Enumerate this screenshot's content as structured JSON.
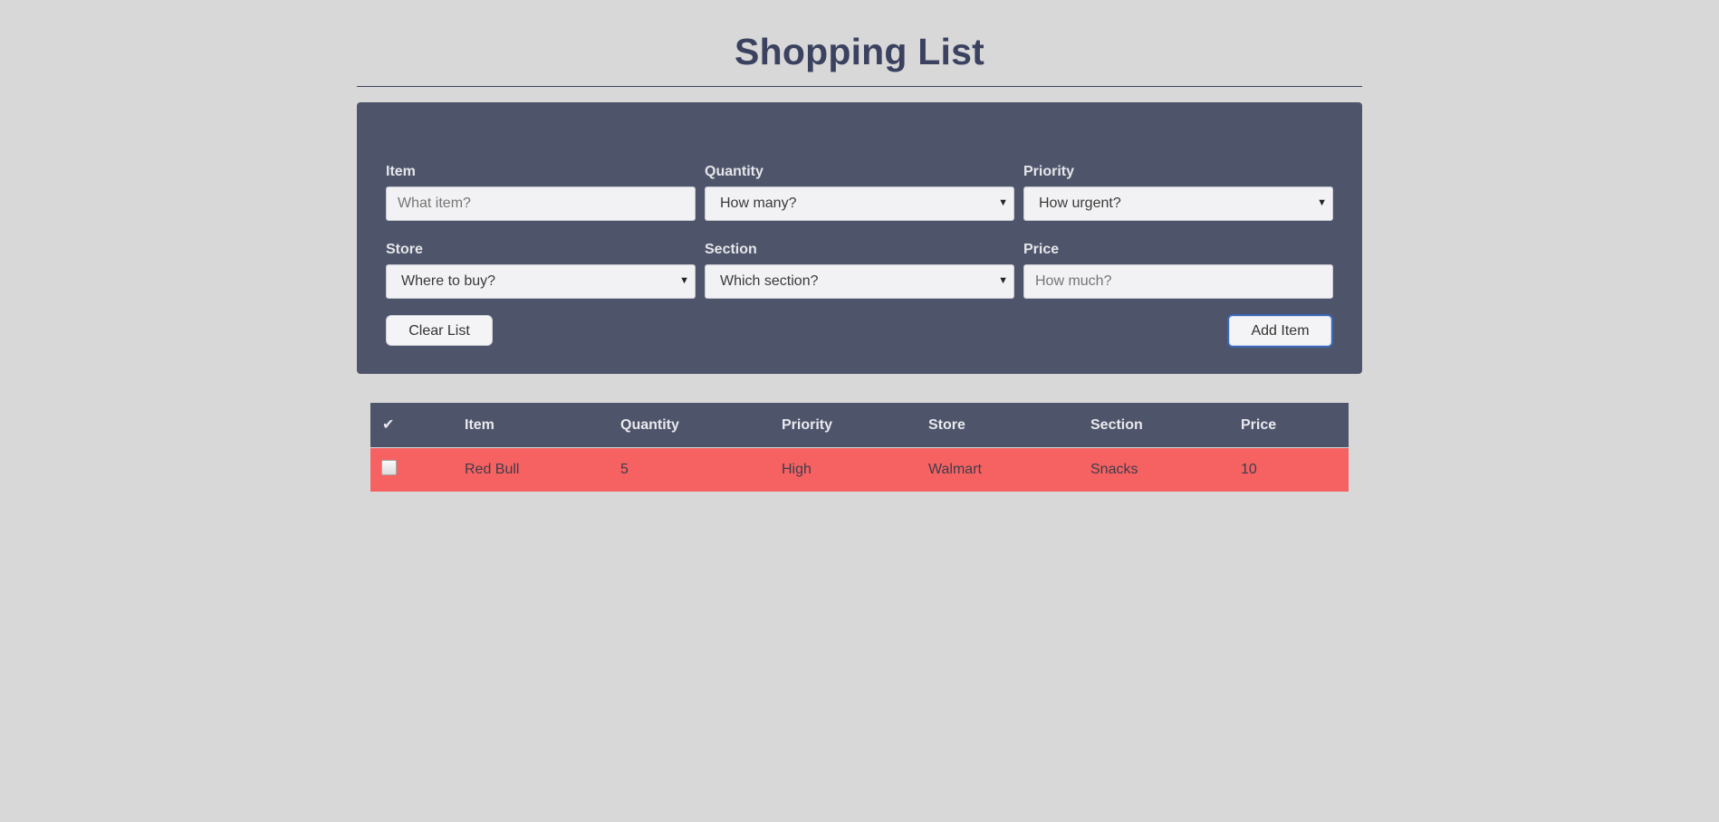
{
  "page": {
    "title": "Shopping List"
  },
  "form": {
    "item": {
      "label": "Item",
      "placeholder": "What item?"
    },
    "quantity": {
      "label": "Quantity",
      "selected": "How many?"
    },
    "priority": {
      "label": "Priority",
      "selected": "How urgent?"
    },
    "store": {
      "label": "Store",
      "selected": "Where to buy?"
    },
    "section": {
      "label": "Section",
      "selected": "Which section?"
    },
    "price": {
      "label": "Price",
      "placeholder": "How much?"
    },
    "clear_label": "Clear List",
    "add_label": "Add Item"
  },
  "table": {
    "headers": {
      "check": "✔",
      "item": "Item",
      "quantity": "Quantity",
      "priority": "Priority",
      "store": "Store",
      "section": "Section",
      "price": "Price"
    },
    "rows": [
      {
        "checked": false,
        "item": "Red Bull",
        "quantity": "5",
        "priority": "High",
        "store": "Walmart",
        "section": "Snacks",
        "price": "10"
      }
    ]
  },
  "colors": {
    "background": "#d8d8d8",
    "panel": "#4e546a",
    "title": "#3b4260",
    "high_priority_row": "#f66262"
  }
}
